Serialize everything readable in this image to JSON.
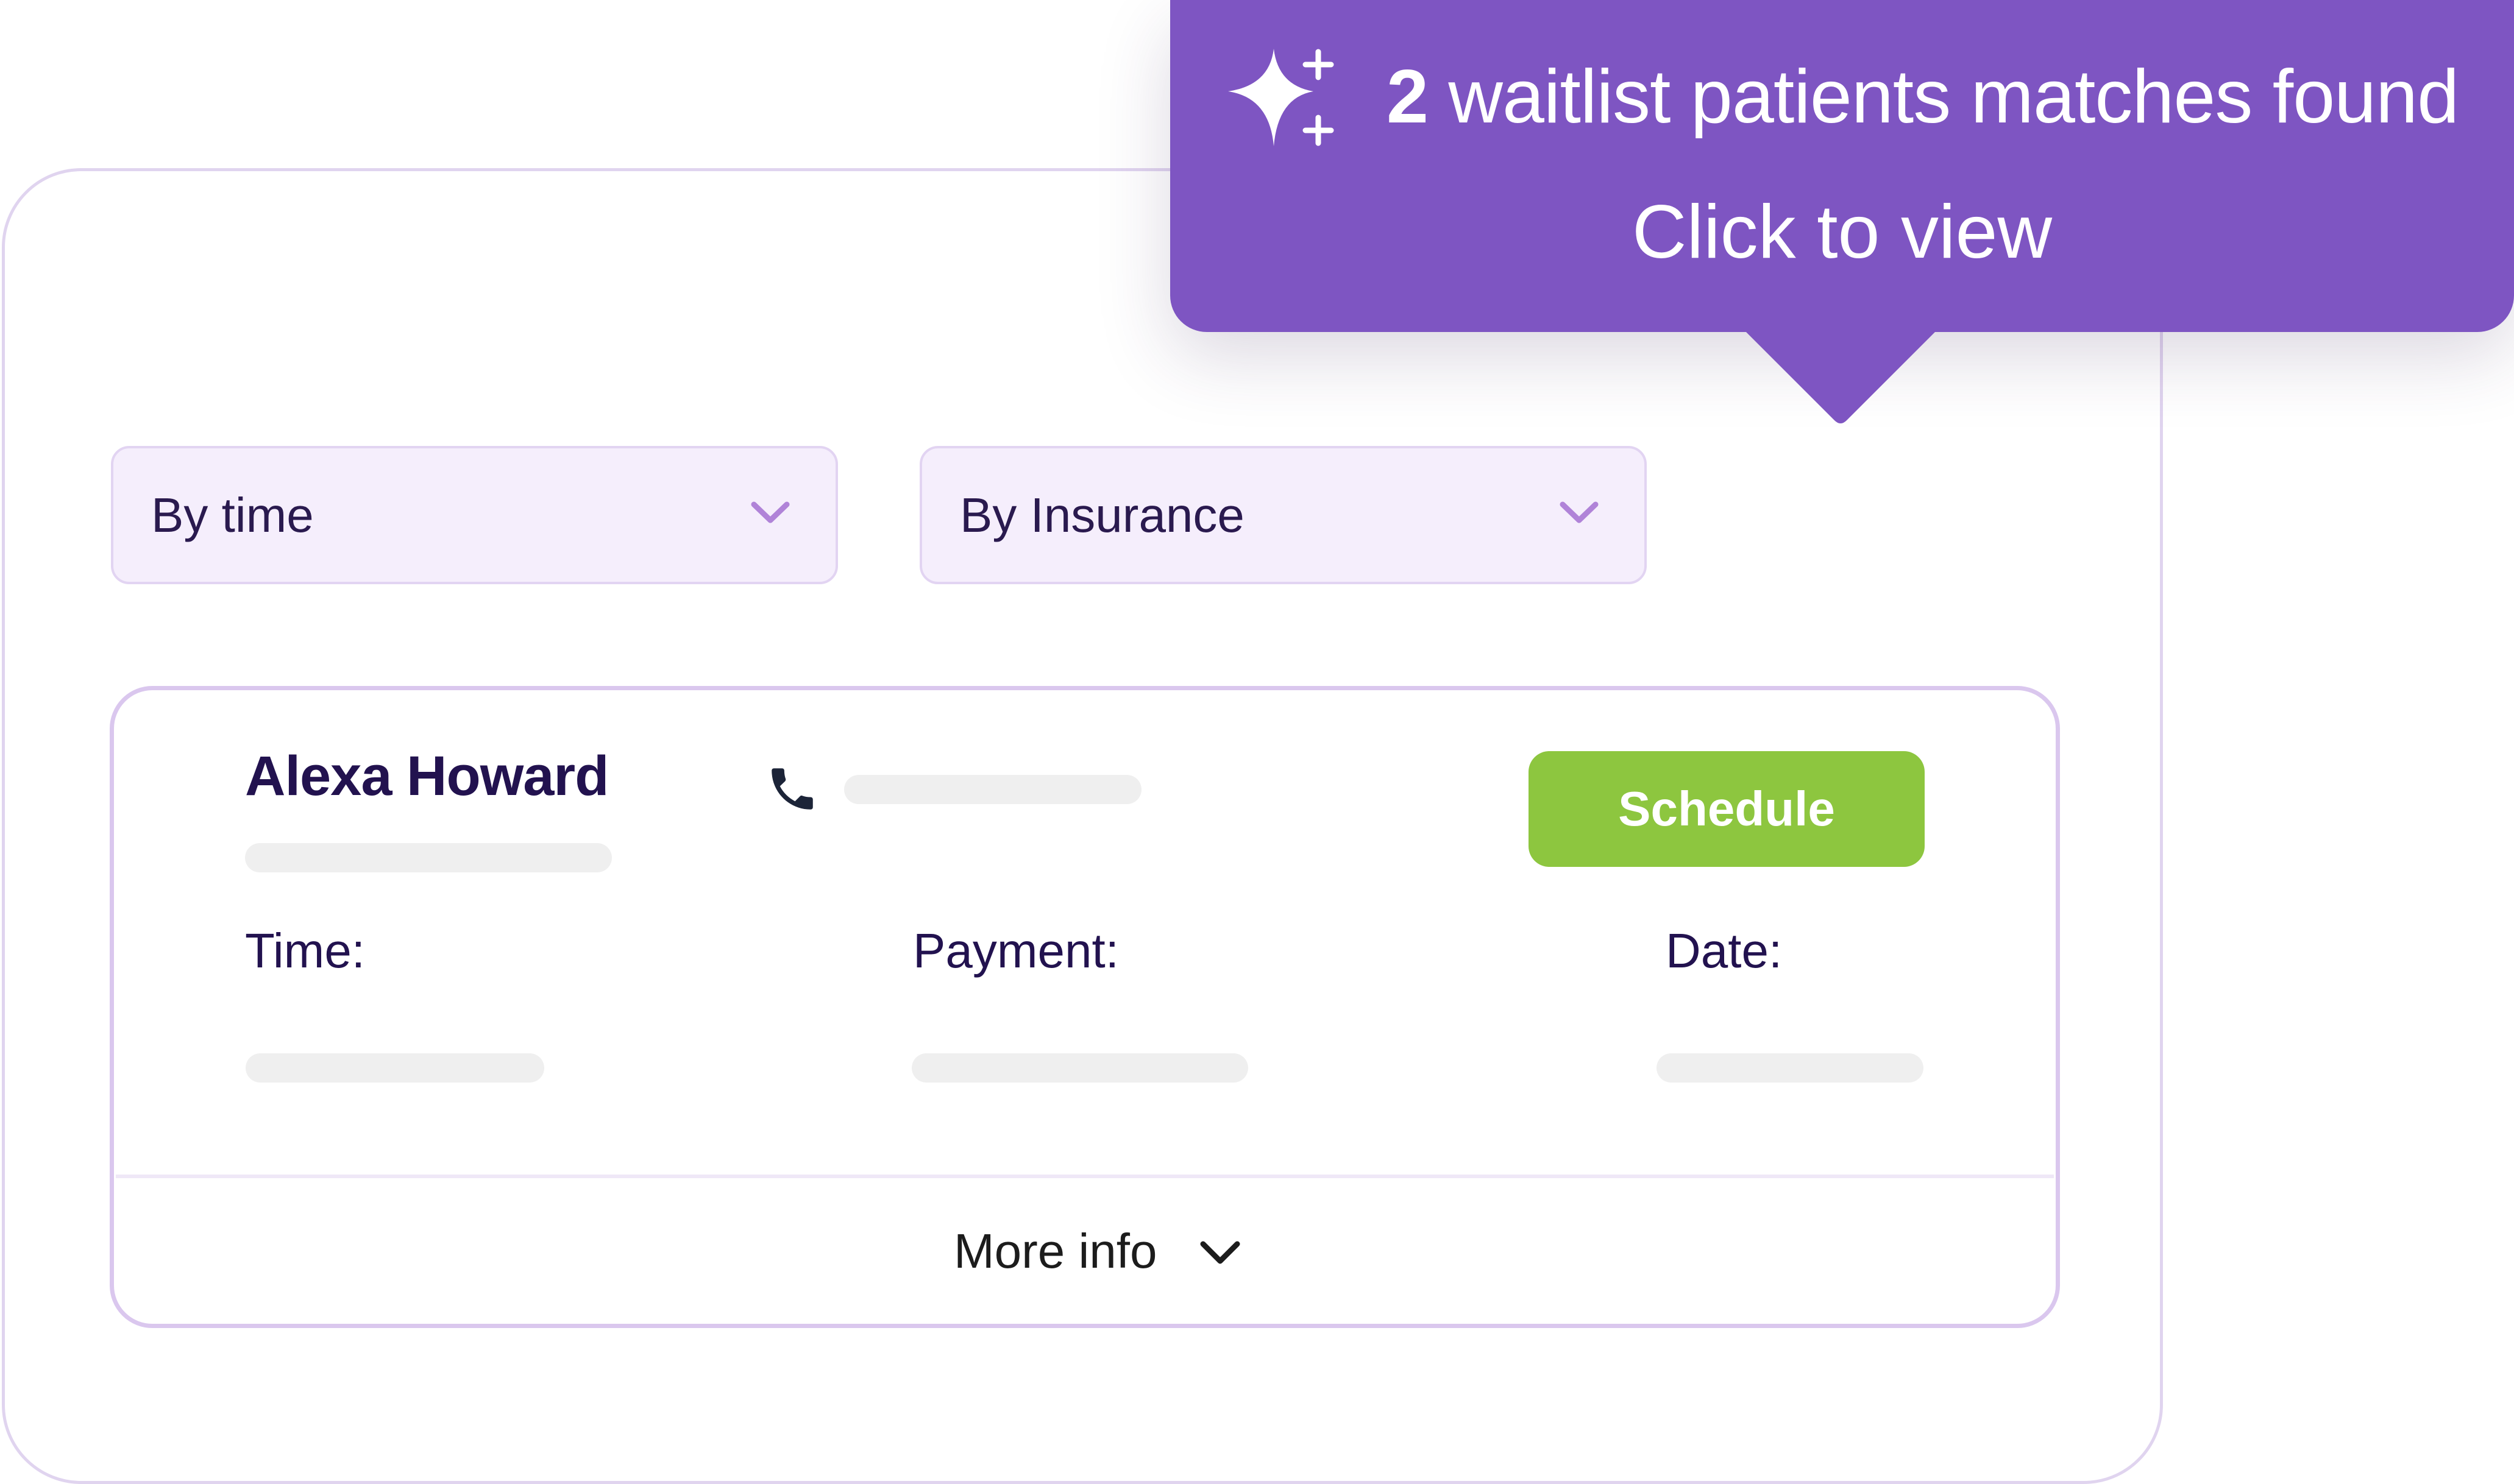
{
  "colors": {
    "accent_purple": "#7e55c2",
    "schedule_green": "#8dc63f",
    "heading_navy": "#22124f",
    "filter_bg": "#f5eefc",
    "card_border": "#dac7ee",
    "placeholder_grey": "#efefef"
  },
  "toast": {
    "count": "2",
    "message": " waitlist patients matches found",
    "action": "Click to view",
    "icon": "sparkle-icon"
  },
  "filters": [
    {
      "label": "By time",
      "icon": "chevron-down-icon"
    },
    {
      "label": "By Insurance",
      "icon": "chevron-down-icon"
    }
  ],
  "patient": {
    "name": "Alexa Howard",
    "phone_icon": "phone-icon",
    "schedule_label": "Schedule",
    "fields": [
      {
        "label": "Time:"
      },
      {
        "label": "Payment:"
      },
      {
        "label": "Date:"
      }
    ],
    "more_info_label": "More info",
    "more_info_icon": "chevron-down-icon"
  }
}
